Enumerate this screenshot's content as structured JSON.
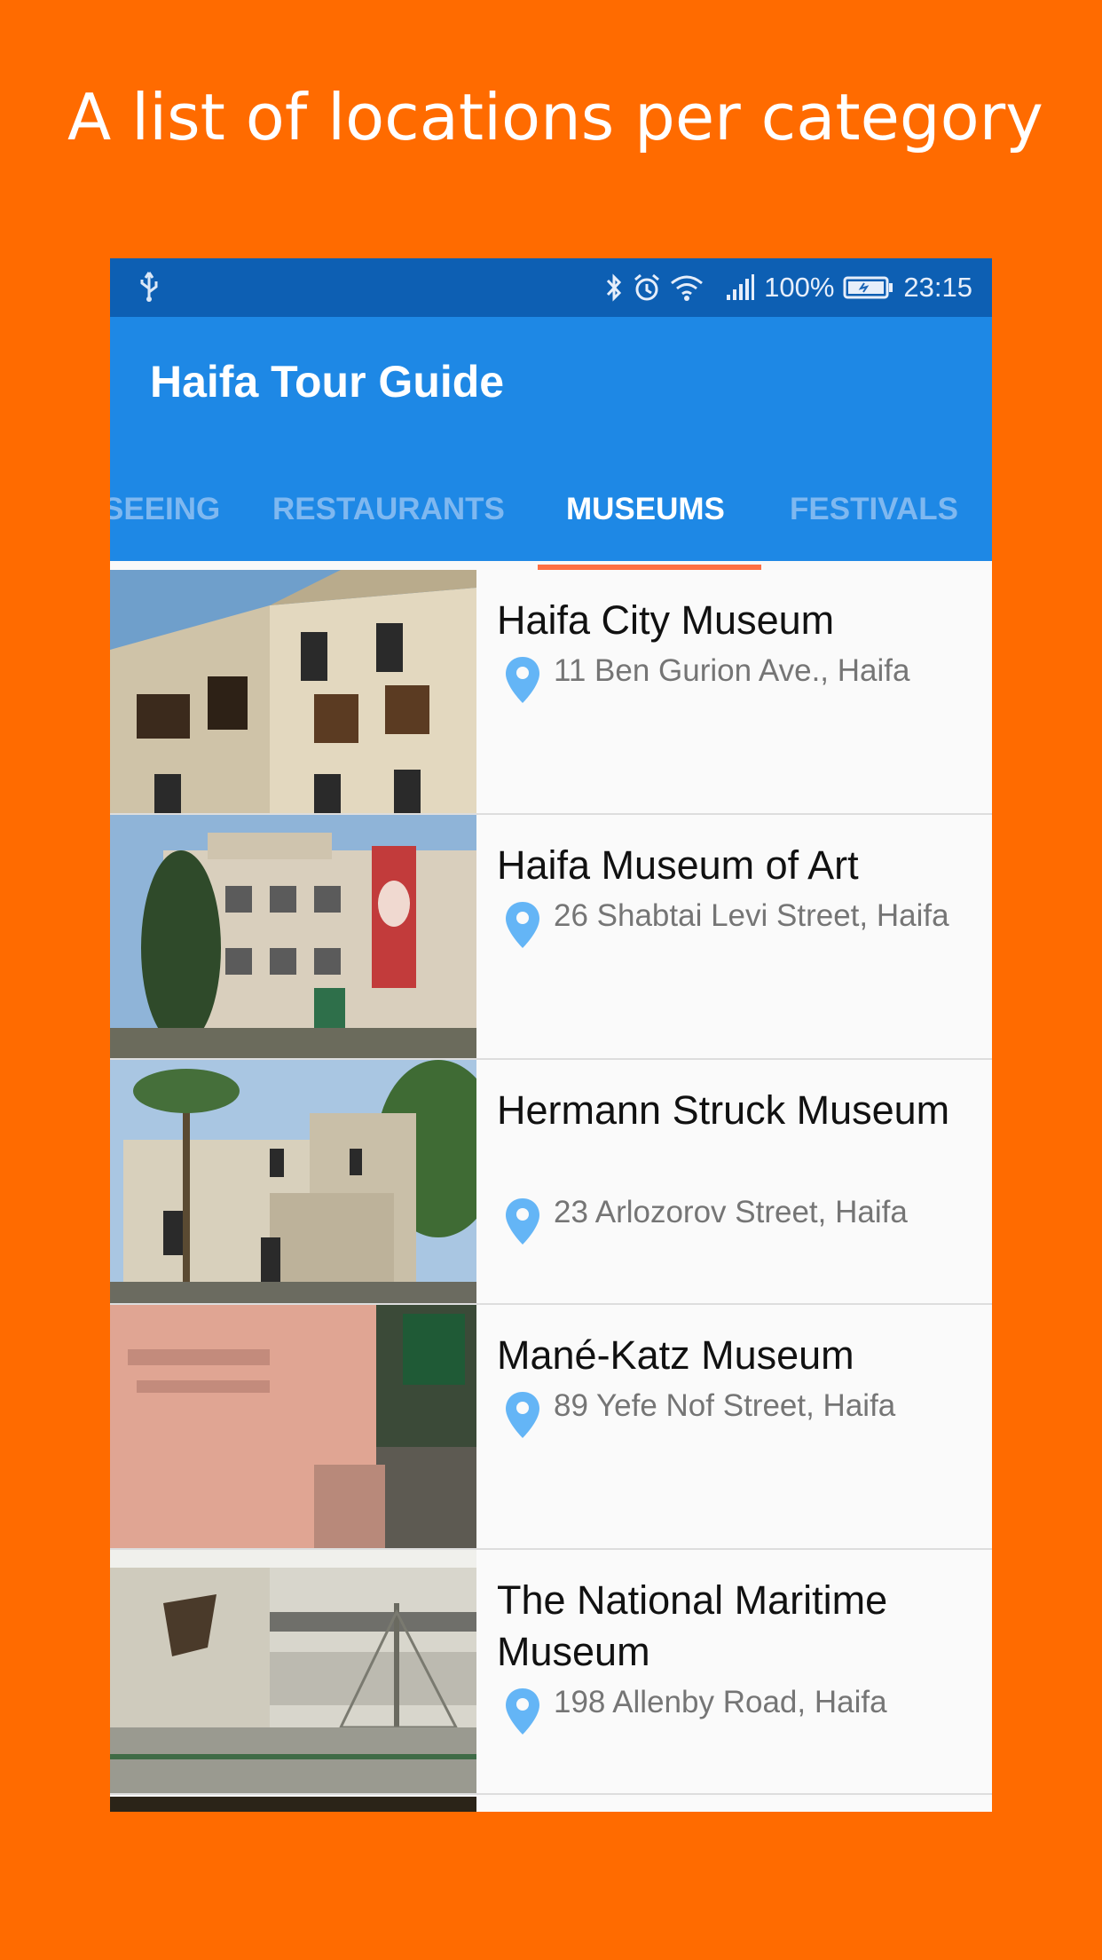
{
  "promo": {
    "title": "A list of locations per category"
  },
  "status_bar": {
    "battery_text": "100%",
    "time": "23:15"
  },
  "app": {
    "title": "Haifa Tour Guide"
  },
  "tabs": [
    {
      "label": "SEEING",
      "active": false
    },
    {
      "label": "RESTAURANTS",
      "active": false
    },
    {
      "label": "MUSEUMS",
      "active": true
    },
    {
      "label": "FESTIVALS",
      "active": false
    }
  ],
  "locations": [
    {
      "name": "Haifa City Museum",
      "address": "11 Ben Gurion Ave., Haifa"
    },
    {
      "name": "Haifa Museum of Art",
      "address": "26 Shabtai Levi Street, Haifa"
    },
    {
      "name": "Hermann Struck Museum",
      "address": "23 Arlozorov Street, Haifa"
    },
    {
      "name": "Mané-Katz Museum",
      "address": "89 Yefe Nof Street, Haifa"
    },
    {
      "name": "The National Maritime Museum",
      "address": "198 Allenby Road, Haifa"
    }
  ],
  "colors": {
    "background": "#FF6B00",
    "status_bar": "#0D5FB3",
    "primary": "#1E88E5",
    "tab_indicator": "#FF7043",
    "pin": "#64B5F6"
  },
  "icons": [
    "usb-icon",
    "bluetooth-icon",
    "alarm-icon",
    "wifi-icon",
    "signal-icon",
    "battery-icon",
    "location-pin-icon"
  ]
}
